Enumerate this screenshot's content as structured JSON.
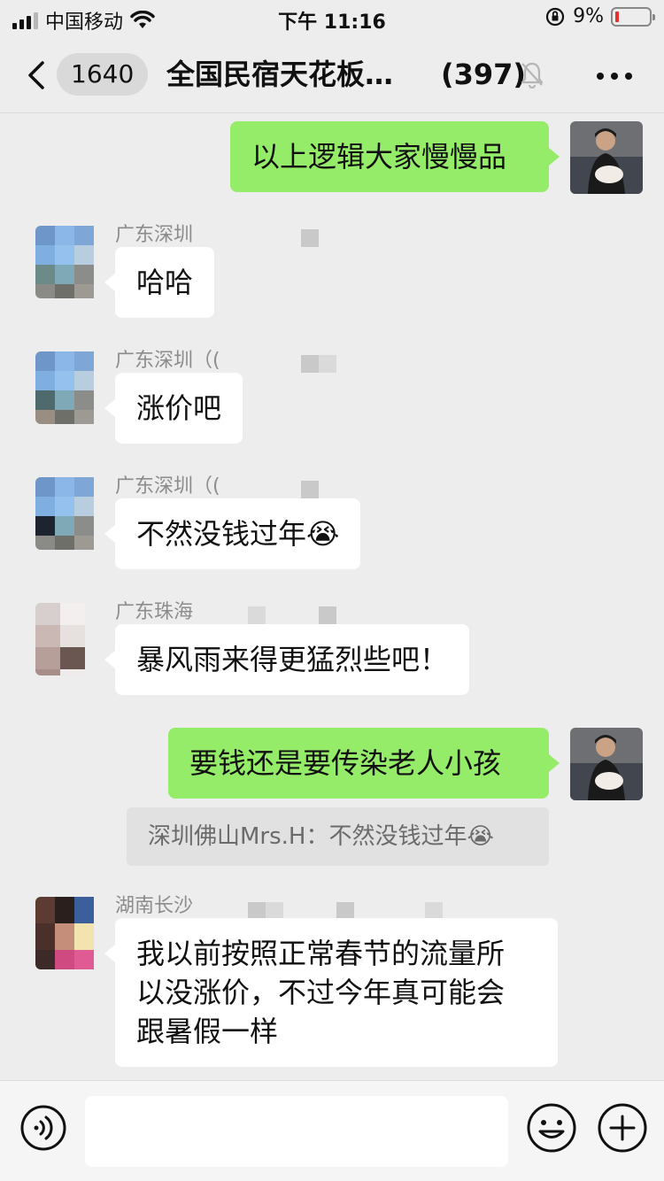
{
  "status_bar": {
    "carrier": "中国移动",
    "time": "下午 11:16",
    "battery_percent": "9%",
    "battery_level": 0.09
  },
  "nav": {
    "back_icon": "chevron-left-icon",
    "unread_count": "1640",
    "title": "全国民宿天花板…",
    "member_count": "(397)",
    "mute_icon": "bell-muted-icon",
    "more_icon": "more-dots-icon"
  },
  "messages": [
    {
      "type": "outgoing",
      "text": "以上逻辑大家慢慢品"
    },
    {
      "type": "incoming",
      "sender": "广东深圳",
      "text": "哈哈"
    },
    {
      "type": "incoming",
      "sender": "广东深圳（(",
      "text": "涨价吧"
    },
    {
      "type": "incoming",
      "sender": "广东深圳（(",
      "text": "不然没钱过年",
      "emoji": "😭"
    },
    {
      "type": "incoming",
      "sender": "广东珠海",
      "text": "暴风雨来得更猛烈些吧！"
    },
    {
      "type": "outgoing",
      "text": "要钱还是要传染老人小孩"
    },
    {
      "type": "quote",
      "text": "深圳佛山Mrs.H：不然没钱过年",
      "emoji": "😭"
    },
    {
      "type": "incoming",
      "sender": "湖南长沙",
      "text": "我以前按照正常春节的流量所\n以没涨价，不过今年真可能会\n跟暑假一样"
    }
  ],
  "input_bar": {
    "voice_icon": "voice-icon",
    "input_value": "",
    "emoji_icon": "emoji-icon",
    "plus_icon": "plus-icon"
  },
  "colors": {
    "background": "#ededed",
    "outgoing_bubble": "#95ec69",
    "incoming_bubble": "#ffffff",
    "sender_text": "#8c8c8c"
  }
}
